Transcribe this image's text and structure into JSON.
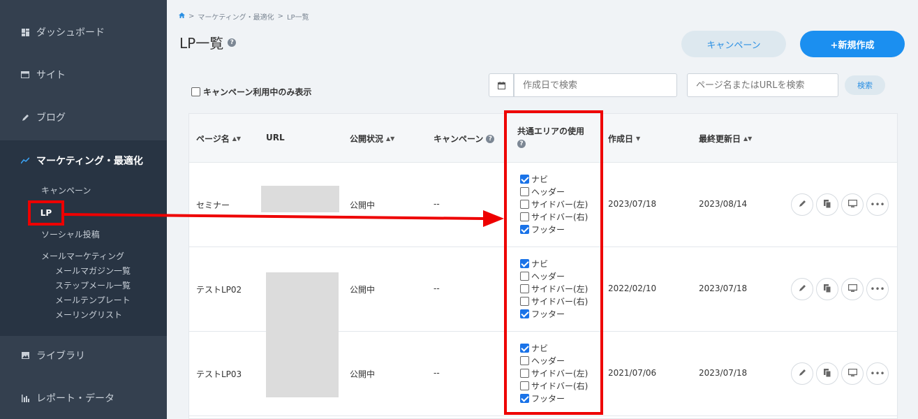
{
  "sidebar": {
    "items": [
      {
        "label": "ダッシュボード",
        "icon": "dashboard-icon"
      },
      {
        "label": "サイト",
        "icon": "site-icon"
      },
      {
        "label": "ブログ",
        "icon": "pencil-icon"
      },
      {
        "label": "マーケティング・最適化",
        "icon": "chart-line-icon"
      },
      {
        "label": "ライブラリ",
        "icon": "image-icon"
      },
      {
        "label": "レポート・データ",
        "icon": "bar-chart-icon"
      }
    ],
    "marketing_sub": {
      "campaign": "キャンペーン",
      "lp": "LP",
      "social": "ソーシャル投稿",
      "mail_marketing": "メールマーケティング",
      "mail_items": [
        "メールマガジン一覧",
        "ステップメール一覧",
        "メールテンプレート",
        "メーリングリスト"
      ]
    }
  },
  "breadcrumb": {
    "home_icon": "home-icon",
    "sep": ">",
    "item1": "マーケティング・最適化",
    "item2": "LP一覧"
  },
  "header": {
    "title": "LP一覧",
    "campaign_button": "キャンペーン",
    "new_button": "+新規作成"
  },
  "filters": {
    "campaign_only_label": "キャンペーン利用中のみ表示",
    "date_placeholder": "作成日で検索",
    "search_placeholder": "ページ名またはURLを検索",
    "search_button": "検索"
  },
  "table": {
    "columns": {
      "page_name": "ページ名",
      "url": "URL",
      "status": "公開状況",
      "campaign": "キャンペーン",
      "common_area": "共通エリアの使用",
      "created": "作成日",
      "updated": "最終更新日"
    },
    "area_labels": [
      "ナビ",
      "ヘッダー",
      "サイドバー(左)",
      "サイドバー(右)",
      "フッター"
    ],
    "rows": [
      {
        "name": "セミナー",
        "status": "公開中",
        "campaign": "--",
        "areas": [
          true,
          false,
          false,
          false,
          true
        ],
        "created": "2023/07/18",
        "updated": "2023/08/14"
      },
      {
        "name": "テストLP02",
        "status": "公開中",
        "campaign": "--",
        "areas": [
          true,
          false,
          false,
          false,
          true
        ],
        "created": "2022/02/10",
        "updated": "2023/07/18"
      },
      {
        "name": "テストLP03",
        "status": "公開中",
        "campaign": "--",
        "areas": [
          true,
          false,
          false,
          false,
          true
        ],
        "created": "2021/07/06",
        "updated": "2023/07/18"
      }
    ]
  },
  "colors": {
    "sidebar": "#34404f",
    "accent": "#1b8ff0",
    "highlight": "#e00000"
  }
}
